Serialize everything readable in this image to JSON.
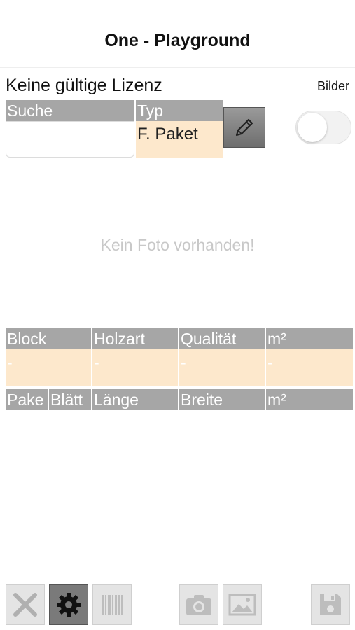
{
  "nav": {
    "title": "One - Playground"
  },
  "license": {
    "text": "Keine gültige Lizenz"
  },
  "bilder_label": "Bilder",
  "search": {
    "label": "Suche",
    "value": ""
  },
  "type": {
    "label": "Typ",
    "value": "F. Paket"
  },
  "photo": {
    "empty_text": "Kein Foto vorhanden!"
  },
  "table1": {
    "headers": [
      "Block",
      "Holzart",
      "Qualität",
      "m²"
    ],
    "values": [
      "-",
      "-",
      "-",
      "-"
    ]
  },
  "table2": {
    "headers": [
      "Pake",
      "Blätt",
      "Länge",
      "Breite",
      "m²"
    ]
  },
  "toggle": {
    "on": false
  },
  "toolbar": {
    "icons": [
      "close-icon",
      "gear-icon",
      "barcode-icon",
      "camera-icon",
      "image-icon",
      "save-icon"
    ]
  }
}
